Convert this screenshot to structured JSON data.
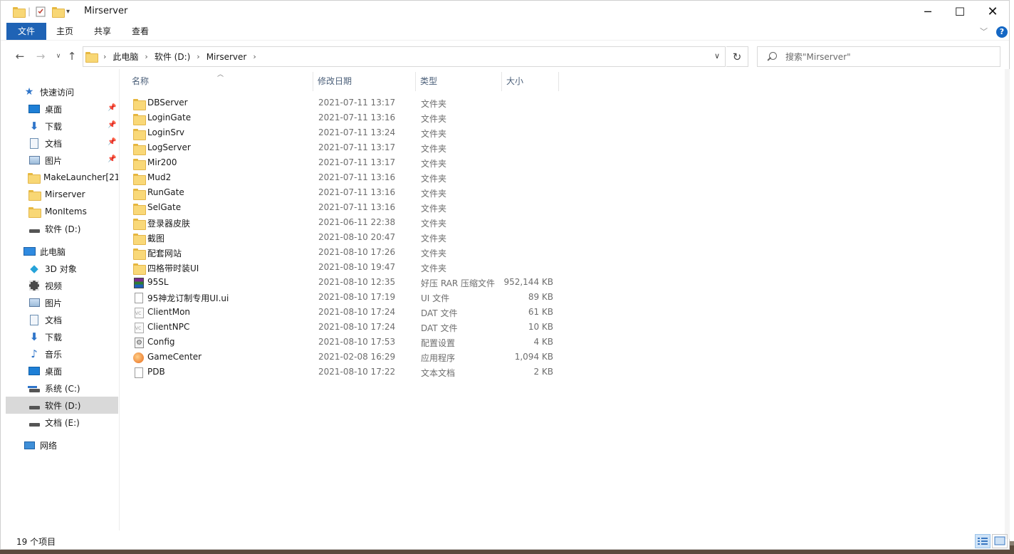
{
  "window": {
    "title": "Mirserver"
  },
  "ribbon": {
    "tabs": [
      {
        "label": "文件",
        "active": true
      },
      {
        "label": "主页"
      },
      {
        "label": "共享"
      },
      {
        "label": "查看"
      }
    ],
    "help": "?"
  },
  "address": {
    "crumbs": [
      "此电脑",
      "软件 (D:)",
      "Mirserver"
    ]
  },
  "search": {
    "placeholder": "搜索\"Mirserver\""
  },
  "sidebar": {
    "items": [
      {
        "label": "快速访问",
        "icon": "star-icon",
        "level": 0
      },
      {
        "label": "桌面",
        "icon": "desktop-icon",
        "level": 1,
        "pinned": true
      },
      {
        "label": "下载",
        "icon": "download-icon",
        "level": 1,
        "pinned": true
      },
      {
        "label": "文档",
        "icon": "document-icon",
        "level": 1,
        "pinned": true
      },
      {
        "label": "图片",
        "icon": "pictures-icon",
        "level": 1,
        "pinned": true
      },
      {
        "label": "MakeLauncher[21",
        "icon": "folder-icon",
        "level": 1
      },
      {
        "label": "Mirserver",
        "icon": "folder-icon",
        "level": 1
      },
      {
        "label": "MonItems",
        "icon": "folder-icon",
        "level": 1
      },
      {
        "label": "软件 (D:)",
        "icon": "drive-icon",
        "level": 1
      },
      {
        "label": "此电脑",
        "icon": "computer-icon",
        "level": 0
      },
      {
        "label": "3D 对象",
        "icon": "3d-objects-icon",
        "level": 1
      },
      {
        "label": "视频",
        "icon": "video-icon",
        "level": 1
      },
      {
        "label": "图片",
        "icon": "pictures-icon",
        "level": 1
      },
      {
        "label": "文档",
        "icon": "document-icon",
        "level": 1
      },
      {
        "label": "下载",
        "icon": "download-icon",
        "level": 1
      },
      {
        "label": "音乐",
        "icon": "music-icon",
        "level": 1
      },
      {
        "label": "桌面",
        "icon": "desktop-icon",
        "level": 1
      },
      {
        "label": "系统 (C:)",
        "icon": "system-drive-icon",
        "level": 1
      },
      {
        "label": "软件 (D:)",
        "icon": "drive-icon",
        "level": 1,
        "selected": true
      },
      {
        "label": "文档 (E:)",
        "icon": "drive-icon",
        "level": 1
      },
      {
        "label": "网络",
        "icon": "network-icon",
        "level": 0
      }
    ]
  },
  "columns": [
    "名称",
    "修改日期",
    "类型",
    "大小"
  ],
  "files": [
    {
      "name": "DBServer",
      "date": "2021-07-11 13:17",
      "type": "文件夹",
      "size": "",
      "icon": "folder"
    },
    {
      "name": "LoginGate",
      "date": "2021-07-11 13:16",
      "type": "文件夹",
      "size": "",
      "icon": "folder"
    },
    {
      "name": "LoginSrv",
      "date": "2021-07-11 13:24",
      "type": "文件夹",
      "size": "",
      "icon": "folder"
    },
    {
      "name": "LogServer",
      "date": "2021-07-11 13:17",
      "type": "文件夹",
      "size": "",
      "icon": "folder"
    },
    {
      "name": "Mir200",
      "date": "2021-07-11 13:17",
      "type": "文件夹",
      "size": "",
      "icon": "folder"
    },
    {
      "name": "Mud2",
      "date": "2021-07-11 13:16",
      "type": "文件夹",
      "size": "",
      "icon": "folder"
    },
    {
      "name": "RunGate",
      "date": "2021-07-11 13:16",
      "type": "文件夹",
      "size": "",
      "icon": "folder"
    },
    {
      "name": "SelGate",
      "date": "2021-07-11 13:16",
      "type": "文件夹",
      "size": "",
      "icon": "folder"
    },
    {
      "name": "登录器皮肤",
      "date": "2021-06-11 22:38",
      "type": "文件夹",
      "size": "",
      "icon": "folder"
    },
    {
      "name": "截图",
      "date": "2021-08-10 20:47",
      "type": "文件夹",
      "size": "",
      "icon": "folder"
    },
    {
      "name": "配套网站",
      "date": "2021-08-10 17:26",
      "type": "文件夹",
      "size": "",
      "icon": "folder"
    },
    {
      "name": "四格带时装UI",
      "date": "2021-08-10 19:47",
      "type": "文件夹",
      "size": "",
      "icon": "folder"
    },
    {
      "name": "95SL",
      "date": "2021-08-10 12:35",
      "type": "好压 RAR 压缩文件",
      "size": "952,144 KB",
      "icon": "rar"
    },
    {
      "name": "95神龙订制专用UI.ui",
      "date": "2021-08-10 17:19",
      "type": "UI 文件",
      "size": "89 KB",
      "icon": "doc"
    },
    {
      "name": "ClientMon",
      "date": "2021-08-10 17:24",
      "type": "DAT 文件",
      "size": "61 KB",
      "icon": "dat"
    },
    {
      "name": "ClientNPC",
      "date": "2021-08-10 17:24",
      "type": "DAT 文件",
      "size": "10 KB",
      "icon": "dat"
    },
    {
      "name": "Config",
      "date": "2021-08-10 17:53",
      "type": "配置设置",
      "size": "4 KB",
      "icon": "cfg"
    },
    {
      "name": "GameCenter",
      "date": "2021-02-08 16:29",
      "type": "应用程序",
      "size": "1,094 KB",
      "icon": "exe"
    },
    {
      "name": "PDB",
      "date": "2021-08-10 17:22",
      "type": "文本文档",
      "size": "2 KB",
      "icon": "doc"
    }
  ],
  "status": {
    "item_count": "19 个项目"
  }
}
